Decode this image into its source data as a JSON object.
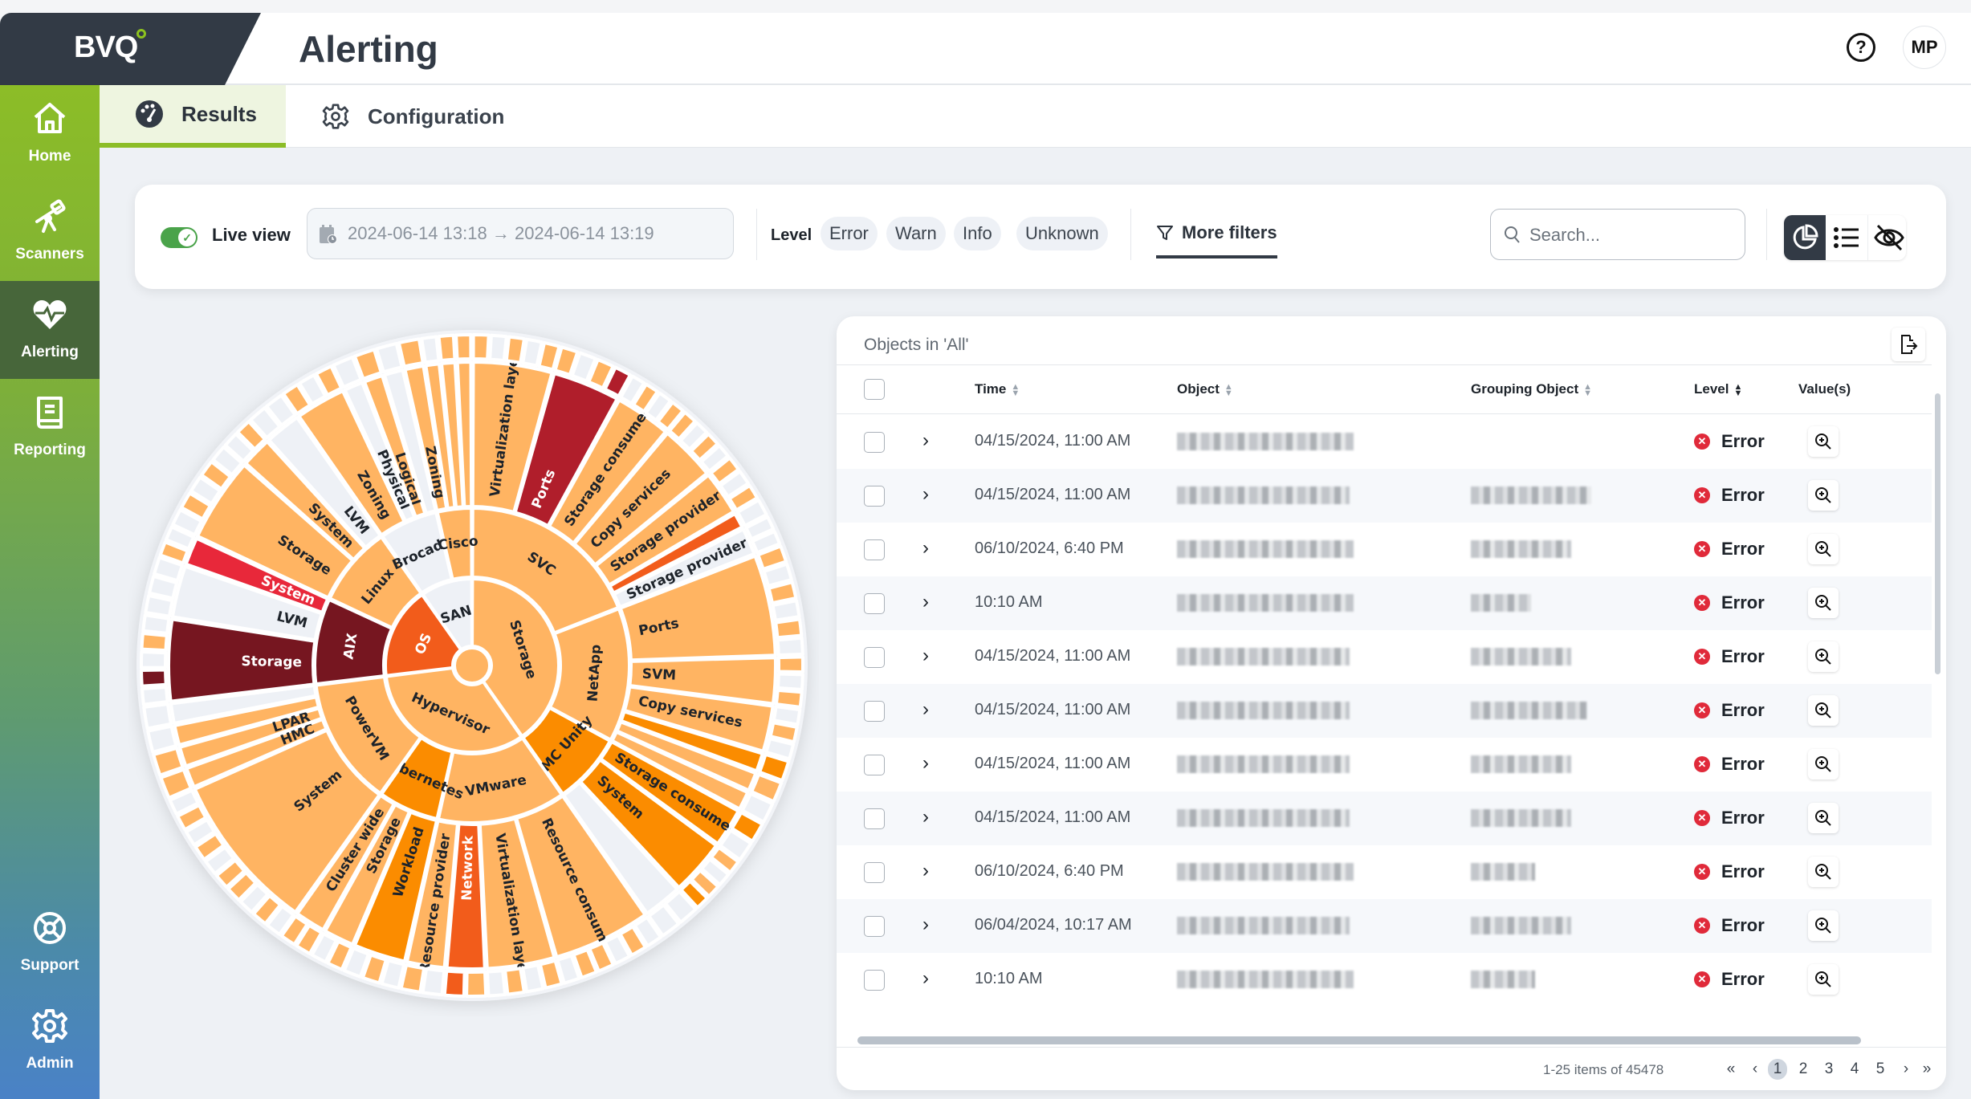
{
  "header": {
    "logo": "BVQ",
    "title": "Alerting",
    "help_icon": "?",
    "user_initials": "MP"
  },
  "sidebar": {
    "items": [
      {
        "label": "Home",
        "icon": "home-icon",
        "active": false
      },
      {
        "label": "Scanners",
        "icon": "telescope-icon",
        "active": false
      },
      {
        "label": "Alerting",
        "icon": "heartbeat-icon",
        "active": true
      },
      {
        "label": "Reporting",
        "icon": "book-icon",
        "active": false
      }
    ],
    "bottom_items": [
      {
        "label": "Support",
        "icon": "lifebuoy-icon"
      },
      {
        "label": "Admin",
        "icon": "gear-icon"
      }
    ]
  },
  "tabs": [
    {
      "label": "Results",
      "icon": "dashboard-icon",
      "active": true
    },
    {
      "label": "Configuration",
      "icon": "gear-icon",
      "active": false
    }
  ],
  "filters": {
    "live_view_label": "Live view",
    "live_view_on": true,
    "date_from": "2024-06-14 13:18",
    "date_to": "2024-06-14 13:19",
    "arrow": "→",
    "level_label": "Level",
    "levels": [
      "Error",
      "Warn",
      "Info",
      "Unknown"
    ],
    "more_filters_label": "More filters",
    "search_placeholder": "Search...",
    "view_modes": [
      "chart",
      "list",
      "hidden"
    ],
    "active_view": "chart"
  },
  "colors": {
    "brand_green": "#8cbd27",
    "dark": "#323a45",
    "error": "#e02a3a",
    "level_ok": "#ffb462",
    "level_light": "#eef1f6",
    "level_orange": "#fb8c00",
    "level_deep_orange": "#f25c1b",
    "level_red": "#e8283a",
    "level_crimson": "#b01e2b",
    "level_maroon": "#761620"
  },
  "chart_data": {
    "type": "sunburst",
    "title": "",
    "levels": [
      "ok",
      "warn",
      "elevated",
      "high",
      "error",
      "critical",
      "none"
    ],
    "root": {
      "name": "",
      "children": [
        {
          "name": "Storage",
          "status": "ok",
          "value": 145,
          "children": [
            {
              "name": "SVC",
              "status": "ok",
              "value": 62,
              "children": [
                {
                  "name": "Virtualization layer",
                  "status": "ok",
                  "value": 14
                },
                {
                  "name": "Ports",
                  "status": "critical-red",
                  "value": 12
                },
                {
                  "name": "Storage consumer",
                  "status": "ok",
                  "value": 10
                },
                {
                  "name": "Copy services",
                  "status": "ok",
                  "value": 10
                },
                {
                  "name": "Storage provider -",
                  "status": "ok",
                  "value": 8
                },
                {
                  "name": "",
                  "status": "high",
                  "value": 3
                },
                {
                  "name": "Storage provider",
                  "status": "none",
                  "value": 5
                }
              ]
            },
            {
              "name": "NetApp",
              "status": "ok",
              "value": 45,
              "children": [
                {
                  "name": "Ports",
                  "status": "ok",
                  "value": 15
                },
                {
                  "name": "SVM",
                  "status": "ok",
                  "value": 7
                },
                {
                  "name": "Copy services",
                  "status": "ok",
                  "value": 7
                },
                {
                  "name": "",
                  "status": "elevated",
                  "value": 3
                },
                {
                  "name": "",
                  "status": "ok",
                  "value": 3
                },
                {
                  "name": "",
                  "status": "ok",
                  "value": 3
                }
              ]
            },
            {
              "name": "EMC Unity",
              "status": "elevated",
              "value": 24,
              "children": [
                {
                  "name": "Storage consumer",
                  "status": "elevated",
                  "value": 7
                },
                {
                  "name": "System",
                  "status": "elevated",
                  "value": 10
                },
                {
                  "name": "",
                  "status": "none",
                  "value": 7
                }
              ]
            }
          ]
        },
        {
          "name": "Hypervisor",
          "status": "ok",
          "value": 118,
          "children": [
            {
              "name": "VMware",
              "status": "ok",
              "value": 46,
              "children": [
                {
                  "name": "Resource consumer",
                  "status": "ok",
                  "value": 20
                },
                {
                  "name": "Virtualization layer",
                  "status": "ok",
                  "value": 14
                },
                {
                  "name": "Network",
                  "status": "high",
                  "value": 8
                },
                {
                  "name": "Resource provider",
                  "status": "ok",
                  "value": 8
                }
              ]
            },
            {
              "name": "Kubernetes",
              "status": "elevated",
              "value": 22,
              "children": [
                {
                  "name": "Workload",
                  "status": "elevated",
                  "value": 10
                },
                {
                  "name": "Storage",
                  "status": "ok",
                  "value": 6
                },
                {
                  "name": "Cluster wide",
                  "status": "ok",
                  "value": 6
                }
              ]
            },
            {
              "name": "PowerVM",
              "status": "ok",
              "value": 46,
              "children": [
                {
                  "name": "System",
                  "status": "ok",
                  "value": 22
                },
                {
                  "name": "HMC",
                  "status": "ok",
                  "value": 3
                },
                {
                  "name": "LPAR",
                  "status": "ok",
                  "value": 3
                },
                {
                  "name": "",
                  "status": "ok",
                  "value": 3
                },
                {
                  "name": "",
                  "status": "none",
                  "value": 3
                }
              ]
            }
          ]
        },
        {
          "name": "OS",
          "status": "high",
          "value": 62,
          "children": [
            {
              "name": "AIX",
              "status": "critical",
              "value": 32,
              "children": [
                {
                  "name": "Storage",
                  "status": "critical",
                  "value": 14
                },
                {
                  "name": "LVM",
                  "status": "none",
                  "value": 9
                },
                {
                  "name": "System",
                  "status": "error",
                  "value": 5
                }
              ]
            },
            {
              "name": "Linux",
              "status": "ok",
              "value": 30,
              "children": [
                {
                  "name": "Storage",
                  "status": "ok",
                  "value": 16
                },
                {
                  "name": "System",
                  "status": "ok",
                  "value": 6
                },
                {
                  "name": "LVM",
                  "status": "none",
                  "value": 7
                }
              ]
            }
          ]
        },
        {
          "name": "SAN",
          "status": "none",
          "value": 35,
          "children": [
            {
              "name": "Brocade",
              "status": "none",
              "value": 22,
              "children": [
                {
                  "name": "Zoning",
                  "status": "ok",
                  "value": 10
                },
                {
                  "name": "Physical",
                  "status": "none",
                  "value": 4
                },
                {
                  "name": "Logical",
                  "status": "ok",
                  "value": 4
                },
                {
                  "name": "",
                  "status": "none",
                  "value": 4
                }
              ]
            },
            {
              "name": "Cisco",
              "status": "ok",
              "value": 13,
              "children": [
                {
                  "name": "Zoning",
                  "status": "ok",
                  "value": 4
                },
                {
                  "name": "",
                  "status": "ok",
                  "value": 3
                },
                {
                  "name": "",
                  "status": "ok",
                  "value": 3
                },
                {
                  "name": "",
                  "status": "ok",
                  "value": 3
                }
              ]
            }
          ]
        }
      ]
    },
    "center_label": "",
    "start_category": "Storage"
  },
  "table": {
    "title": "Objects in 'All'",
    "columns": [
      "Time",
      "Object",
      "Grouping Object",
      "Level",
      "Value(s)"
    ],
    "rows": [
      {
        "time": "04/15/2024, 11:00 AM",
        "object": "[redacted]",
        "grouping": "",
        "level": "Error"
      },
      {
        "time": "04/15/2024, 11:00 AM",
        "object": "[redacted]",
        "grouping": "[redacted]",
        "level": "Error"
      },
      {
        "time": "06/10/2024, 6:40 PM",
        "object": "[redacted]",
        "grouping": "[redacted]",
        "level": "Error"
      },
      {
        "time": "10:10 AM",
        "object": "[redacted]",
        "grouping": "[redacted]",
        "level": "Error"
      },
      {
        "time": "04/15/2024, 11:00 AM",
        "object": "[redacted]",
        "grouping": "[redacted]",
        "level": "Error"
      },
      {
        "time": "04/15/2024, 11:00 AM",
        "object": "[redacted]",
        "grouping": "[redacted]",
        "level": "Error"
      },
      {
        "time": "04/15/2024, 11:00 AM",
        "object": "[redacted]",
        "grouping": "[redacted]",
        "level": "Error"
      },
      {
        "time": "04/15/2024, 11:00 AM",
        "object": "[redacted]",
        "grouping": "[redacted]",
        "level": "Error"
      },
      {
        "time": "06/10/2024, 6:40 PM",
        "object": "[redacted]",
        "grouping": "[redacted]",
        "level": "Error"
      },
      {
        "time": "06/04/2024, 10:17 AM",
        "object": "[redacted]",
        "grouping": "[redacted]",
        "level": "Error"
      },
      {
        "time": "10:10 AM",
        "object": "[redacted]",
        "grouping": "[redacted]",
        "level": "Error"
      }
    ],
    "pagination": {
      "info": "1-25 items of 45478",
      "pages": [
        "1",
        "2",
        "3",
        "4",
        "5"
      ],
      "current_page": "1",
      "first": "«",
      "prev": "‹",
      "next": "›",
      "last": "»"
    }
  }
}
